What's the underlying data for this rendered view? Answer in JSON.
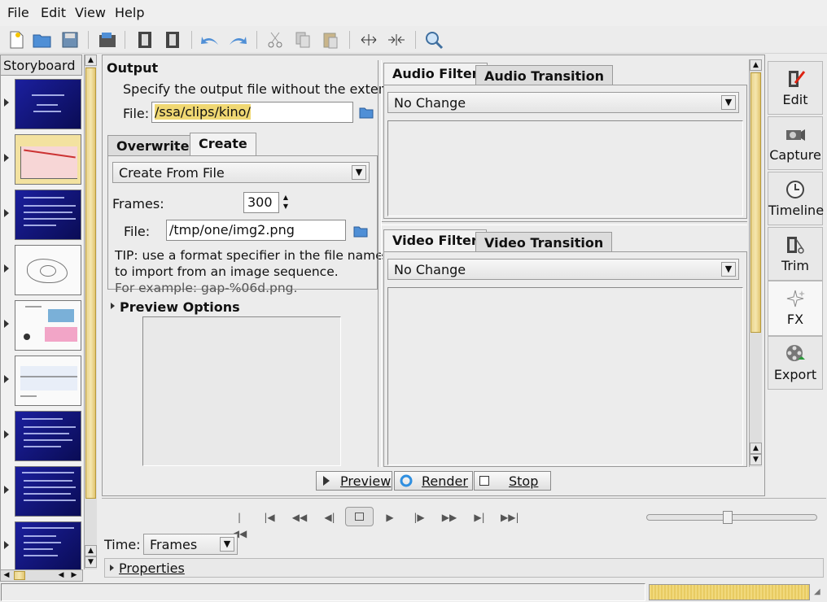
{
  "menu": [
    "File",
    "Edit",
    "View",
    "Help"
  ],
  "storyboard": {
    "title": "Storyboard",
    "thumbs": [
      "blue",
      "yellow",
      "blue",
      "white",
      "white",
      "white",
      "blue",
      "blue",
      "blue"
    ]
  },
  "output": {
    "heading": "Output",
    "hint": "Specify the output file without the extension",
    "file_label": "File:",
    "file_value": "/ssa/clips/kino/",
    "tabs": [
      "Overwrite",
      "Create"
    ],
    "create_combo": "Create From File",
    "frames_label": "Frames:",
    "frames_value": "300",
    "file2_label": "File:",
    "file2_value": "/tmp/one/img2.png",
    "tip_line1": "TIP: use a format specifier in the file name",
    "tip_line2": "to import from an image sequence.",
    "tip_line3": "For example: gap-%06d.png."
  },
  "preview_options": {
    "label": "Preview Options"
  },
  "audio": {
    "tabs": [
      "Audio Filter",
      "Audio Transition"
    ],
    "combo": "No Change"
  },
  "video": {
    "tabs": [
      "Video Filter",
      "Video Transition"
    ],
    "combo": "No Change"
  },
  "actions": {
    "preview": "Preview",
    "render": "Render",
    "stop": "Stop"
  },
  "sidebar": [
    {
      "label": "Edit",
      "icon": "edit-icon"
    },
    {
      "label": "Capture",
      "icon": "camera-icon"
    },
    {
      "label": "Timeline",
      "icon": "clock-icon"
    },
    {
      "label": "Trim",
      "icon": "scissors-icon"
    },
    {
      "label": "FX",
      "icon": "sparkle-icon"
    },
    {
      "label": "Export",
      "icon": "film-reel-icon"
    }
  ],
  "time": {
    "label": "Time:",
    "combo": "Frames"
  },
  "properties": {
    "label": "Properties"
  }
}
